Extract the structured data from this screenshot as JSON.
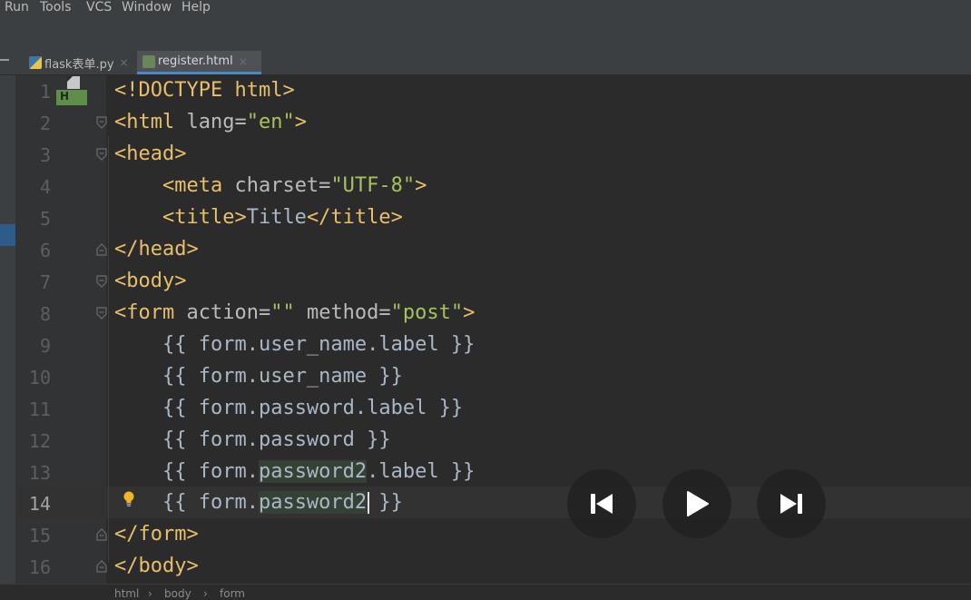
{
  "menu": {
    "run": "Run",
    "tools": "Tools",
    "vcs": "VCS",
    "window": "Window",
    "help": "Help"
  },
  "tabs": [
    {
      "label": "flask表单.py",
      "close": "×",
      "icon": "python-file-icon"
    },
    {
      "label": "register.html",
      "close": "×",
      "icon": "html-file-icon"
    }
  ],
  "line_numbers": [
    "1",
    "2",
    "3",
    "4",
    "5",
    "6",
    "7",
    "8",
    "9",
    "10",
    "11",
    "12",
    "13",
    "14",
    "15",
    "16"
  ],
  "current_line": "14",
  "code": {
    "l1": {
      "tag": "<!DOCTYPE",
      "rest": " html>"
    },
    "l2": {
      "open": "<html",
      "attr": " lang=",
      "val": "\"en\"",
      "close": ">"
    },
    "l3": "<head>",
    "l4": {
      "open": "<meta",
      "attr": " charset=",
      "val": "\"UTF-8\"",
      "close": ">"
    },
    "l5": {
      "open": "<title>",
      "text": "Title",
      "close": "</title>"
    },
    "l6": "</head>",
    "l7": "<body>",
    "l8": {
      "open": "<form",
      "attr1": " action=",
      "val1": "\"\"",
      "attr2": " method=",
      "val2": "\"post\"",
      "close": ">"
    },
    "l9": {
      "a": "{{ form.",
      "b": "user_name.label }}"
    },
    "l10": {
      "a": "{{ form.",
      "b": "user_name }}"
    },
    "l11": {
      "a": "{{ form.",
      "b": "password.label }}"
    },
    "l12": {
      "a": "{{ form.",
      "b": "password }}"
    },
    "l13": {
      "a": "{{ form.",
      "hl": "password2",
      "b": ".label }}"
    },
    "l14": {
      "a": "{{ form.",
      "hl": "password2",
      "b": " }}"
    },
    "l15": "</form>",
    "l16": "</body>"
  },
  "file_icon_letter": "H",
  "breadcrumb": [
    "html",
    "body",
    "form"
  ],
  "breadcrumb_sep": "›",
  "media": {
    "prev": "previous-track-icon",
    "play": "play-icon",
    "next": "next-track-icon"
  },
  "colors": {
    "tag": "#e8bf6a",
    "string": "#a5c25c",
    "attr": "#bababa",
    "text": "#a9b7c6"
  }
}
